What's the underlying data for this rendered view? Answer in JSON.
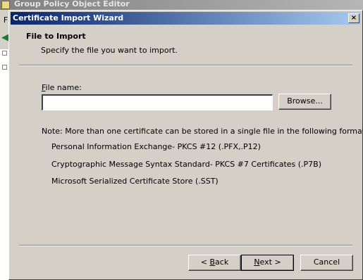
{
  "background_app": {
    "title": "Group Policy Object Editor",
    "menu_fragment": "F",
    "toolbar_fragment": "◀"
  },
  "dialog": {
    "title": "Certificate Import Wizard",
    "close_glyph": "×",
    "header": {
      "title": "File to Import",
      "subtitle": "Specify the file you want to import."
    },
    "file_name": {
      "label_first": "F",
      "label_rest": "ile name:",
      "value": "",
      "placeholder": ""
    },
    "browse_button": {
      "label": "Browse..."
    },
    "note": "Note:  More than one certificate can be stored in a single file in the following formats:",
    "formats": [
      "Personal Information Exchange- PKCS #12 (.PFX,.P12)",
      "Cryptographic Message Syntax Standard- PKCS #7 Certificates (.P7B)",
      "Microsoft Serialized Certificate Store (.SST)"
    ],
    "buttons": {
      "back_prefix": "< ",
      "back_mnemonic": "B",
      "back_rest": "ack",
      "next_mnemonic": "N",
      "next_rest": "ext >",
      "cancel": "Cancel"
    }
  }
}
